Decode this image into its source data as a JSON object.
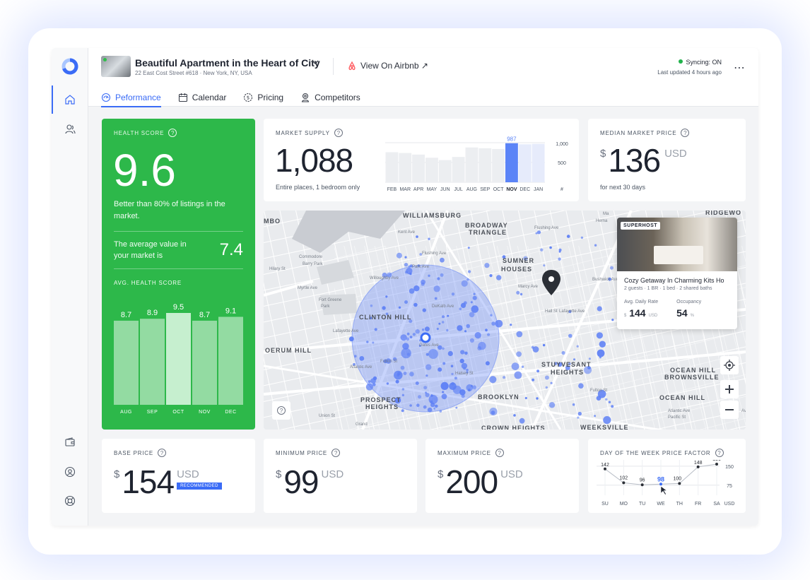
{
  "listing": {
    "title": "Beautiful Apartment in the Heart of City",
    "address": "22 East Cost Street #618 · New York, NY, USA",
    "airbnb_link": "View On Airbnb ↗",
    "sync_status": "Syncing: ON",
    "last_updated": "Last updated 4 hours ago"
  },
  "tabs": [
    {
      "label": "Peformance",
      "icon": "gauge-icon"
    },
    {
      "label": "Calendar",
      "icon": "calendar-icon"
    },
    {
      "label": "Pricing",
      "icon": "gear-dollar-icon"
    },
    {
      "label": "Competitors",
      "icon": "user-pin-icon"
    }
  ],
  "sidebar": {
    "items": [
      "home-icon",
      "users-icon",
      "wallet-icon",
      "user-circle-icon",
      "lifebuoy-icon"
    ]
  },
  "colors": {
    "accent": "#3b6cf6",
    "health_green": "#2db84a",
    "sync_green": "#22b24c"
  },
  "health": {
    "label": "HEALTH SCORE",
    "score": "9.6",
    "description": "Better than 80% of listings in the market.",
    "avg_text": "The average value in your market is",
    "avg_value": "7.4",
    "chart_label": "AVG. HEALTH SCORE"
  },
  "market_supply": {
    "label": "MARKET SUPPLY",
    "value": "1,088",
    "note": "Entire places, 1 bedroom only",
    "axis_labels": [
      "1,000",
      "500",
      "#"
    ]
  },
  "median_price": {
    "label": "MEDIAN MARKET PRICE",
    "currency": "$",
    "value": "136",
    "unit": "USD",
    "note": "for next 30 days"
  },
  "map": {
    "neighborhoods": [
      "WILLIAMSBURG",
      "BROADWAY",
      "TRIANGLE",
      "SUMNER",
      "HOUSES",
      "CLINTON HILL",
      "OERUM HILL",
      "STUYVESANT",
      "HEIGHTS",
      "BROOKLYN",
      "PROSPECT",
      "HEIGHTS",
      "CROWN HEIGHTS",
      "OCEAN HILL",
      "BROWNSVILLE",
      "OCEAN HILL",
      "RIDGEWO",
      "MBO",
      "WEEKSVILLE"
    ],
    "streets": [
      "Commodore",
      "Barry Park",
      "Fort Greene",
      "Park",
      "Flushing Ave",
      "Park Ave",
      "Myrtle Ave",
      "Willoughby Ave",
      "DeKalb Ave",
      "Lafayette Ave",
      "Gates Ave",
      "Fulton St",
      "Atlantic Ave",
      "Halsey St",
      "Grand",
      "Union St",
      "Hilary St",
      "Flushing Ave",
      "Bushwick Ave",
      "Kent Ave",
      "Marcy Ave",
      "Atlantic Ave",
      "Pacific St",
      "Lafayette Ave",
      "Fulton St",
      "Hall St",
      "Ma",
      "Herna",
      "Ave"
    ],
    "popup": {
      "badge": "SUPERHOST",
      "title": "Cozy Getaway In Charming Kits Ho",
      "subtitle": "2 guests · 1 BR · 1 bed · 2 shared baths",
      "adr_label": "Avg. Daily Rate",
      "adr_currency": "$",
      "adr_value": "144",
      "adr_unit": "USD",
      "occ_label": "Occupancy",
      "occ_value": "54",
      "occ_unit": "%"
    }
  },
  "base_price": {
    "label": "BASE PRICE",
    "currency": "$",
    "value": "154",
    "unit": "USD",
    "badge": "RECOMMENDED"
  },
  "min_price": {
    "label": "MINIMUM PRICE",
    "currency": "$",
    "value": "99",
    "unit": "USD"
  },
  "max_price": {
    "label": "MAXIMUM PRICE",
    "currency": "$",
    "value": "200",
    "unit": "USD"
  },
  "dow": {
    "label": "DAY OF THE WEEK PRICE FACTOR",
    "axis_labels": [
      "150",
      "75",
      "USD"
    ]
  },
  "chart_data": [
    {
      "type": "bar",
      "title": "AVG. HEALTH SCORE",
      "categories": [
        "AUG",
        "SEP",
        "OCT",
        "NOV",
        "DEC"
      ],
      "values": [
        8.7,
        8.9,
        9.5,
        8.7,
        9.1
      ],
      "highlight": "OCT",
      "ylim": [
        0,
        9.5
      ]
    },
    {
      "type": "bar",
      "title": "MARKET SUPPLY",
      "categories": [
        "FEB",
        "MAR",
        "APR",
        "MAY",
        "JUN",
        "JUL",
        "AUG",
        "SEP",
        "OCT",
        "NOV",
        "DEC",
        "JAN"
      ],
      "values": [
        760,
        740,
        700,
        620,
        560,
        640,
        880,
        860,
        840,
        987,
        960,
        970
      ],
      "highlight": "NOV",
      "highlight_label": "987",
      "ylim": [
        0,
        1000
      ],
      "grid": true
    },
    {
      "type": "line",
      "title": "DAY OF THE WEEK PRICE FACTOR",
      "categories": [
        "SU",
        "MO",
        "TU",
        "WE",
        "TH",
        "FR",
        "SA"
      ],
      "values": [
        142,
        102,
        96,
        98,
        100,
        148,
        156
      ],
      "highlight": "WE",
      "ylim": [
        70,
        160
      ],
      "grid": true
    }
  ]
}
